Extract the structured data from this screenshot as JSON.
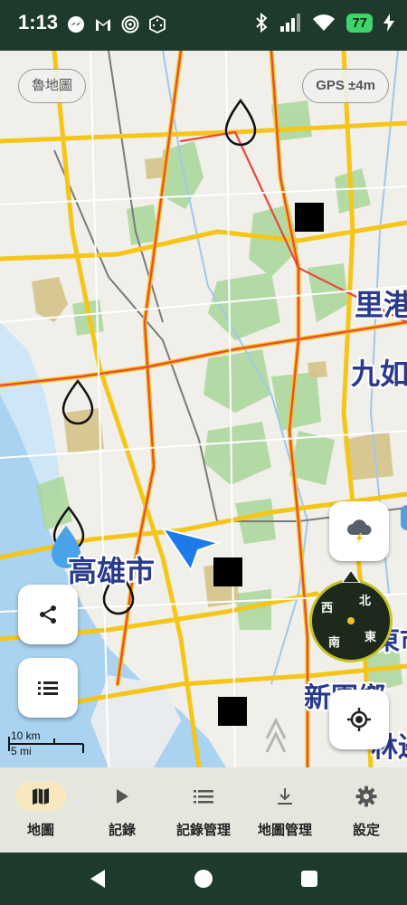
{
  "status_bar": {
    "time": "1:13",
    "battery": "77"
  },
  "map": {
    "map_source_chip": "魯地圖",
    "gps_chip": "GPS ±4m",
    "labels": [
      {
        "id": "kaohsiung",
        "text": "高雄市"
      },
      {
        "id": "ligang",
        "text": "里港"
      },
      {
        "id": "jiuru",
        "text": "九如"
      },
      {
        "id": "pingtung",
        "text": "屏東市"
      },
      {
        "id": "xinyuan",
        "text": "新園鄉"
      },
      {
        "id": "linbian",
        "text": "林邊"
      }
    ],
    "scale": {
      "km": "10 km",
      "mi": "5 mi"
    },
    "compass": {
      "north": "北",
      "east": "東",
      "south": "南",
      "west": "西"
    }
  },
  "bottom_nav": [
    {
      "label": "地圖",
      "icon": "map-icon",
      "active": true
    },
    {
      "label": "記錄",
      "icon": "play-icon",
      "active": false
    },
    {
      "label": "記錄管理",
      "icon": "list-icon",
      "active": false
    },
    {
      "label": "地圖管理",
      "icon": "download-icon",
      "active": false
    },
    {
      "label": "設定",
      "icon": "gear-icon",
      "active": false
    }
  ],
  "colors": {
    "status_bar_bg": "#1e3a2c",
    "map_bg": "#f1efe9",
    "road_major": "#f5c518",
    "road_red": "#e8483a",
    "water": "#a9d3f0",
    "forest": "#a9d79a",
    "compass_ring": "#c6c229",
    "nav_active": "#f7e9bd",
    "city_label": "#2a3a8c"
  }
}
